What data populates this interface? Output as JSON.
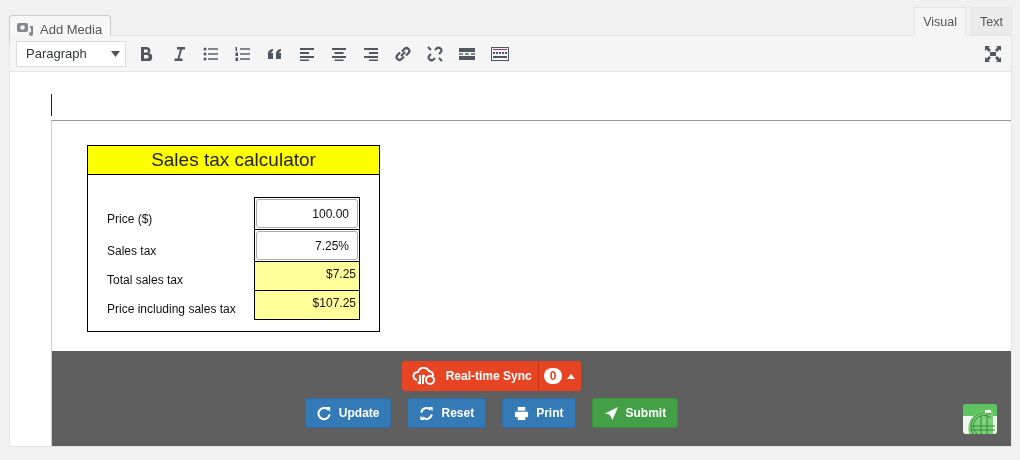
{
  "add_media_button": {
    "label": "Add Media"
  },
  "tabs": [
    {
      "label": "Visual",
      "selected": true
    },
    {
      "label": "Text",
      "selected": false
    }
  ],
  "toolbar": {
    "format_select": "Paragraph"
  },
  "calculator": {
    "title": "Sales tax calculator",
    "rows": [
      {
        "label": "Price ($)",
        "value": "100.00",
        "kind": "input"
      },
      {
        "label": "Sales tax",
        "value": "7.25%",
        "kind": "input"
      },
      {
        "label": "Total sales tax",
        "value": "$7.25",
        "kind": "output"
      },
      {
        "label": "Price including sales tax",
        "value": "$107.25",
        "kind": "output"
      }
    ]
  },
  "sync": {
    "label": "Real-time Sync",
    "count": "0"
  },
  "actions": [
    {
      "label": "Update",
      "kind": "update"
    },
    {
      "label": "Reset",
      "kind": "reset"
    },
    {
      "label": "Print",
      "kind": "print"
    },
    {
      "label": "Submit",
      "kind": "submit"
    }
  ]
}
